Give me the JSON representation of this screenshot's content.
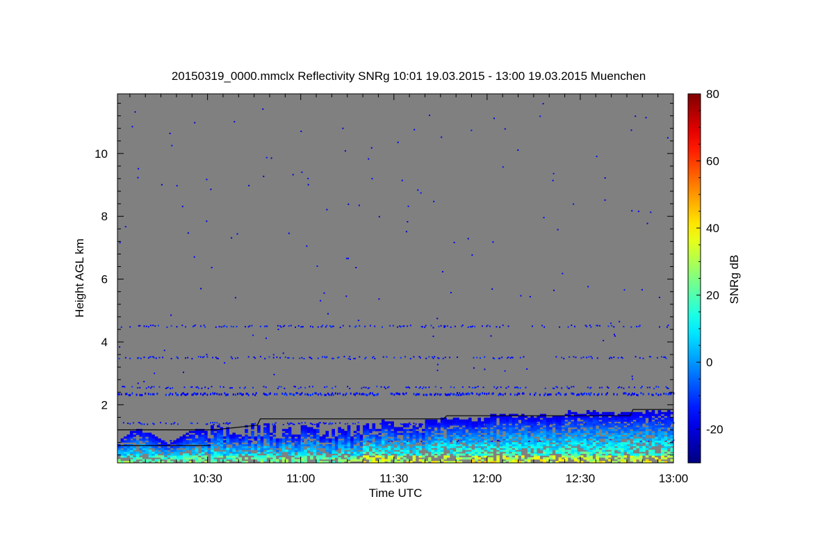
{
  "chart_data": {
    "type": "heatmap",
    "title": "20150319_0000.mmclx Reflectivity SNRg   10:01 19.03.2015 - 13:00 19.03.2015 Muenchen",
    "xlabel": "Time UTC",
    "ylabel": "Height AGL km",
    "colorbar_label": "SNRg dB",
    "x_range": [
      "10:01",
      "13:00"
    ],
    "x_ticks": [
      "10:30",
      "11:00",
      "11:30",
      "12:00",
      "12:30",
      "13:00"
    ],
    "y_range": [
      0.15,
      11.9
    ],
    "y_ticks": [
      2,
      4,
      6,
      8,
      10
    ],
    "color_range": [
      -30,
      80
    ],
    "color_ticks": [
      -20,
      0,
      20,
      40,
      60,
      80
    ],
    "colormap": "jet",
    "background_color": "#808080",
    "noise_bands_km": [
      4.5,
      3.5,
      2.55,
      2.35,
      1.4,
      0.85
    ],
    "cloud_top_line_km": [
      [
        "10:01",
        1.2
      ],
      [
        "10:32",
        1.2
      ],
      [
        "10:46",
        1.35
      ],
      [
        "10:47",
        1.55
      ],
      [
        "11:46",
        1.55
      ],
      [
        "11:47",
        1.65
      ],
      [
        "12:46",
        1.65
      ],
      [
        "12:47",
        1.85
      ],
      [
        "13:00",
        1.85
      ]
    ],
    "lower_line_km": [
      [
        "10:01",
        0.7
      ],
      [
        "10:31",
        0.7
      ]
    ]
  }
}
